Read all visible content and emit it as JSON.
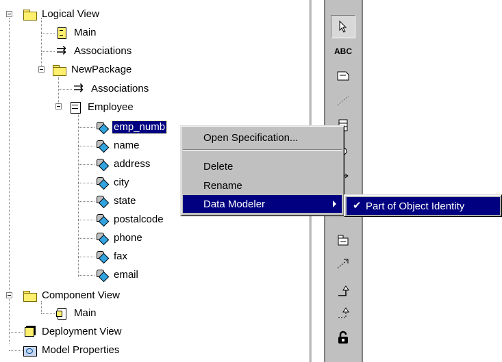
{
  "tree": {
    "logical_view": "Logical View",
    "main": "Main",
    "associations": "Associations",
    "new_package": "NewPackage",
    "pkg_associations": "Associations",
    "employee": "Employee",
    "attributes": [
      "emp_numb",
      "name",
      "address",
      "city",
      "state",
      "postalcode",
      "phone",
      "fax",
      "email"
    ],
    "component_view": "Component View",
    "component_main": "Main",
    "deployment_view": "Deployment View",
    "model_properties": "Model Properties"
  },
  "toolbar": {
    "text_tool_label": "ABC",
    "icons": [
      "select-arrow-icon",
      "text-icon",
      "note-icon",
      "anchor-icon",
      "class-icon",
      "interface-icon",
      "association-icon",
      "package-icon",
      "dependency-icon",
      "generalization-icon",
      "realize-icon",
      "lock-icon"
    ]
  },
  "context_menu": {
    "items": [
      {
        "label": "Open Specification..."
      },
      {
        "label": "Delete"
      },
      {
        "label": "Rename"
      },
      {
        "label": "Data Modeler",
        "has_submenu": true,
        "highlighted": true
      }
    ]
  },
  "submenu": {
    "items": [
      {
        "label": "Part of Object Identity",
        "checked": true,
        "highlighted": true
      }
    ]
  },
  "colors": {
    "selection": "#000080",
    "chrome": "#c0c0c0"
  }
}
